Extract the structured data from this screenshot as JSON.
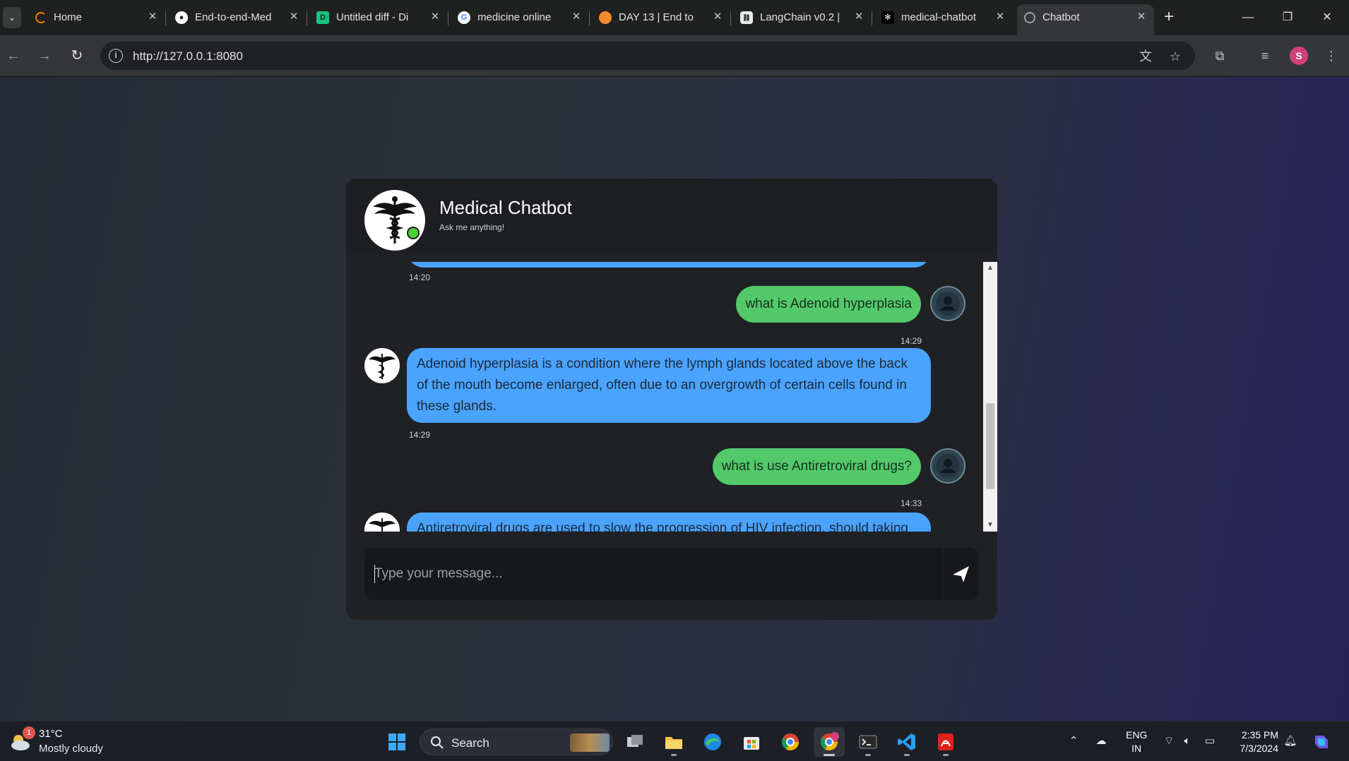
{
  "browser": {
    "tabs": [
      {
        "title": "Home",
        "favicon": "spinner-icon",
        "color": "#f57c00"
      },
      {
        "title": "End-to-end-Med",
        "favicon": "github-icon",
        "color": "#ffffff"
      },
      {
        "title": "Untitled diff - Di",
        "favicon": "diffchecker-icon",
        "color": "#19c37d"
      },
      {
        "title": "medicine online",
        "favicon": "google-icon",
        "color": "#4285f4"
      },
      {
        "title": "DAY 13 | End to",
        "favicon": "course-icon",
        "color": "#f28b2e"
      },
      {
        "title": "LangChain v0.2 |",
        "favicon": "langchain-icon",
        "color": "#ffffff"
      },
      {
        "title": "medical-chatbot",
        "favicon": "openai-icon",
        "color": "#ffffff"
      },
      {
        "title": "Chatbot",
        "favicon": "globe-icon",
        "color": "#9aa0a6"
      }
    ],
    "active_tab": 7,
    "address": "http://127.0.0.1:8080"
  },
  "chat": {
    "title": "Medical Chatbot",
    "subtitle": "Ask me anything!",
    "messages": [
      {
        "from": "bot",
        "text": "",
        "time": "14:20"
      },
      {
        "from": "user",
        "text": "what is Adenoid hyperplasia",
        "time": "14:29"
      },
      {
        "from": "bot",
        "text": "Adenoid hyperplasia is a condition where the lymph glands located above the back of the mouth become enlarged, often due to an overgrowth of certain cells found in these glands.",
        "time": "14:29"
      },
      {
        "from": "user",
        "text": "what is use Antiretroviral drugs?",
        "time": "14:33"
      },
      {
        "from": "bot",
        "text": "Antiretroviral drugs are used to slow the progression of HIV infection, should taking",
        "time": ""
      }
    ],
    "input_placeholder": "Type your message...",
    "input_value": "",
    "colors": {
      "bot_bubble": "#4aa3ff",
      "user_bubble": "#53c96a",
      "online": "#4cd137"
    }
  },
  "taskbar": {
    "weather": {
      "badge": "1",
      "temp": "31°C",
      "condition": "Mostly cloudy"
    },
    "search_label": "Search",
    "apps": [
      "windows-start-icon",
      "task-view-icon",
      "file-explorer-icon",
      "edge-icon",
      "store-icon",
      "chrome-icon",
      "chrome-profile-icon",
      "terminal-icon",
      "vscode-icon",
      "acrobat-icon"
    ],
    "language": {
      "line1": "ENG",
      "line2": "IN"
    },
    "time": "2:35 PM",
    "date": "7/3/2024"
  }
}
